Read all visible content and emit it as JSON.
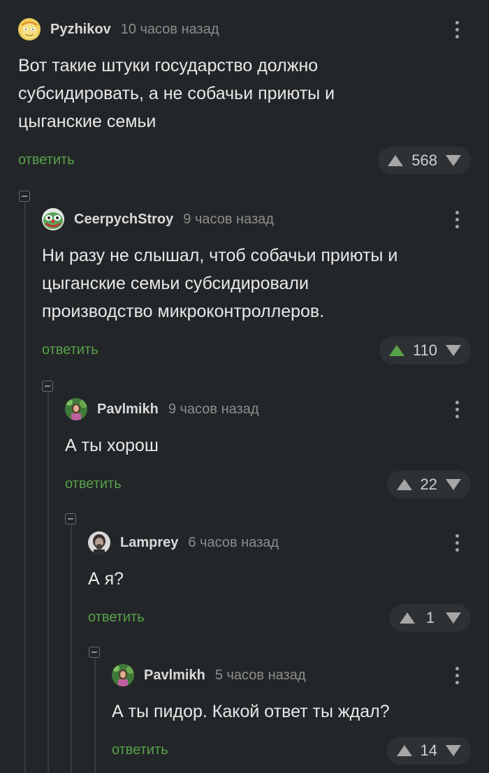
{
  "comments": [
    {
      "username": "Pyzhikov",
      "time": "10 часов назад",
      "text": "Вот такие штуки государство должно\nсубсидировать, а не собачьи приюты и\nцыганские семьи",
      "reply_label": "ответить",
      "votes": "568",
      "upvoted": false,
      "avatar": "yellow-cartoon-avatar"
    },
    {
      "username": "CeerpychStroy",
      "time": "9 часов назад",
      "text": "Ни разу не слышал, чтоб собачьи приюты и\nцыганские семьи субсидировали\nпроизводство микроконтроллеров.",
      "reply_label": "ответить",
      "votes": "110",
      "upvoted": true,
      "avatar": "pepe-clown-avatar"
    },
    {
      "username": "Pavlmikh",
      "time": "9 часов назад",
      "text": "А ты хорош",
      "reply_label": "ответить",
      "votes": "22",
      "upvoted": false,
      "avatar": "woman-photo-avatar"
    },
    {
      "username": "Lamprey",
      "time": "6 часов назад",
      "text": "А я?",
      "reply_label": "ответить",
      "votes": "1",
      "upvoted": false,
      "avatar": "man-photo-avatar"
    },
    {
      "username": "Pavlmikh",
      "time": "5 часов назад",
      "text": "А ты пидор. Какой ответ ты ждал?",
      "reply_label": "ответить",
      "votes": "14",
      "upvoted": false,
      "avatar": "woman-photo-avatar"
    }
  ],
  "colors": {
    "background": "#232628",
    "reply_link": "#58a14b",
    "upvote_active": "#58a14b",
    "vote_arrow": "#a6a6a6",
    "vote_pill": "#2e3133"
  }
}
